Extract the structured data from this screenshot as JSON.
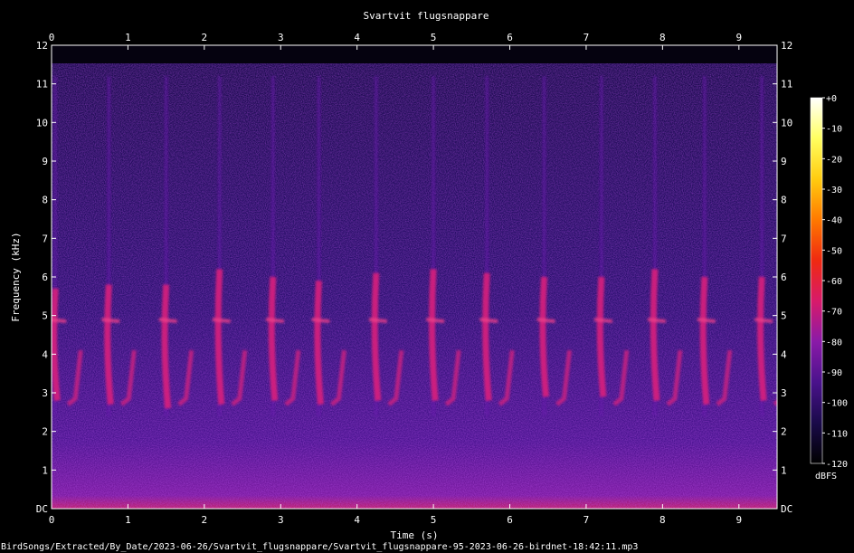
{
  "chart_data": {
    "type": "heatmap",
    "title": "Svartvit flugsnappare",
    "xlabel": "Time (s)",
    "ylabel": "Frequency (kHz)",
    "xlim": [
      0,
      9.5
    ],
    "ylim": [
      0,
      12
    ],
    "x_ticks": [
      "0",
      "1",
      "2",
      "3",
      "4",
      "5",
      "6",
      "7",
      "8",
      "9"
    ],
    "y_ticks": [
      "DC",
      "1",
      "2",
      "3",
      "4",
      "5",
      "6",
      "7",
      "8",
      "9",
      "10",
      "11",
      "12"
    ],
    "colorbar": {
      "label": "dBFS",
      "range": [
        -120,
        0
      ],
      "ticks": [
        "+0",
        "-10",
        "-20",
        "-30",
        "-40",
        "-50",
        "-60",
        "-70",
        "-80",
        "-90",
        "-100",
        "-110",
        "-120"
      ],
      "colors": [
        "#000000",
        "#1a0a4a",
        "#4a128c",
        "#8a1aa8",
        "#d81a6a",
        "#f02a10",
        "#ff7a00",
        "#ffcc10",
        "#ffff60",
        "#ffffff"
      ]
    },
    "background_level_dbfs": -100,
    "syllables": [
      {
        "t": 0.05,
        "f_low": 2.8,
        "f_high": 5.7
      },
      {
        "t": 0.75,
        "f_low": 2.7,
        "f_high": 5.8
      },
      {
        "t": 1.5,
        "f_low": 2.6,
        "f_high": 5.8
      },
      {
        "t": 2.2,
        "f_low": 2.7,
        "f_high": 6.2
      },
      {
        "t": 2.9,
        "f_low": 2.8,
        "f_high": 6.0
      },
      {
        "t": 3.5,
        "f_low": 2.7,
        "f_high": 5.9
      },
      {
        "t": 4.25,
        "f_low": 2.8,
        "f_high": 6.1
      },
      {
        "t": 5.0,
        "f_low": 2.8,
        "f_high": 6.2
      },
      {
        "t": 5.7,
        "f_low": 2.8,
        "f_high": 6.1
      },
      {
        "t": 6.45,
        "f_low": 2.9,
        "f_high": 6.0
      },
      {
        "t": 7.2,
        "f_low": 2.9,
        "f_high": 6.0
      },
      {
        "t": 7.9,
        "f_low": 2.8,
        "f_high": 6.2
      },
      {
        "t": 8.55,
        "f_low": 2.7,
        "f_high": 6.0
      },
      {
        "t": 9.3,
        "f_low": 2.8,
        "f_high": 6.0
      }
    ]
  },
  "footer": {
    "filename": "BirdSongs/Extracted/By_Date/2023-06-26/Svartvit_flugsnappare/Svartvit_flugsnappare-95-2023-06-26-birdnet-18:42:11.mp3"
  }
}
